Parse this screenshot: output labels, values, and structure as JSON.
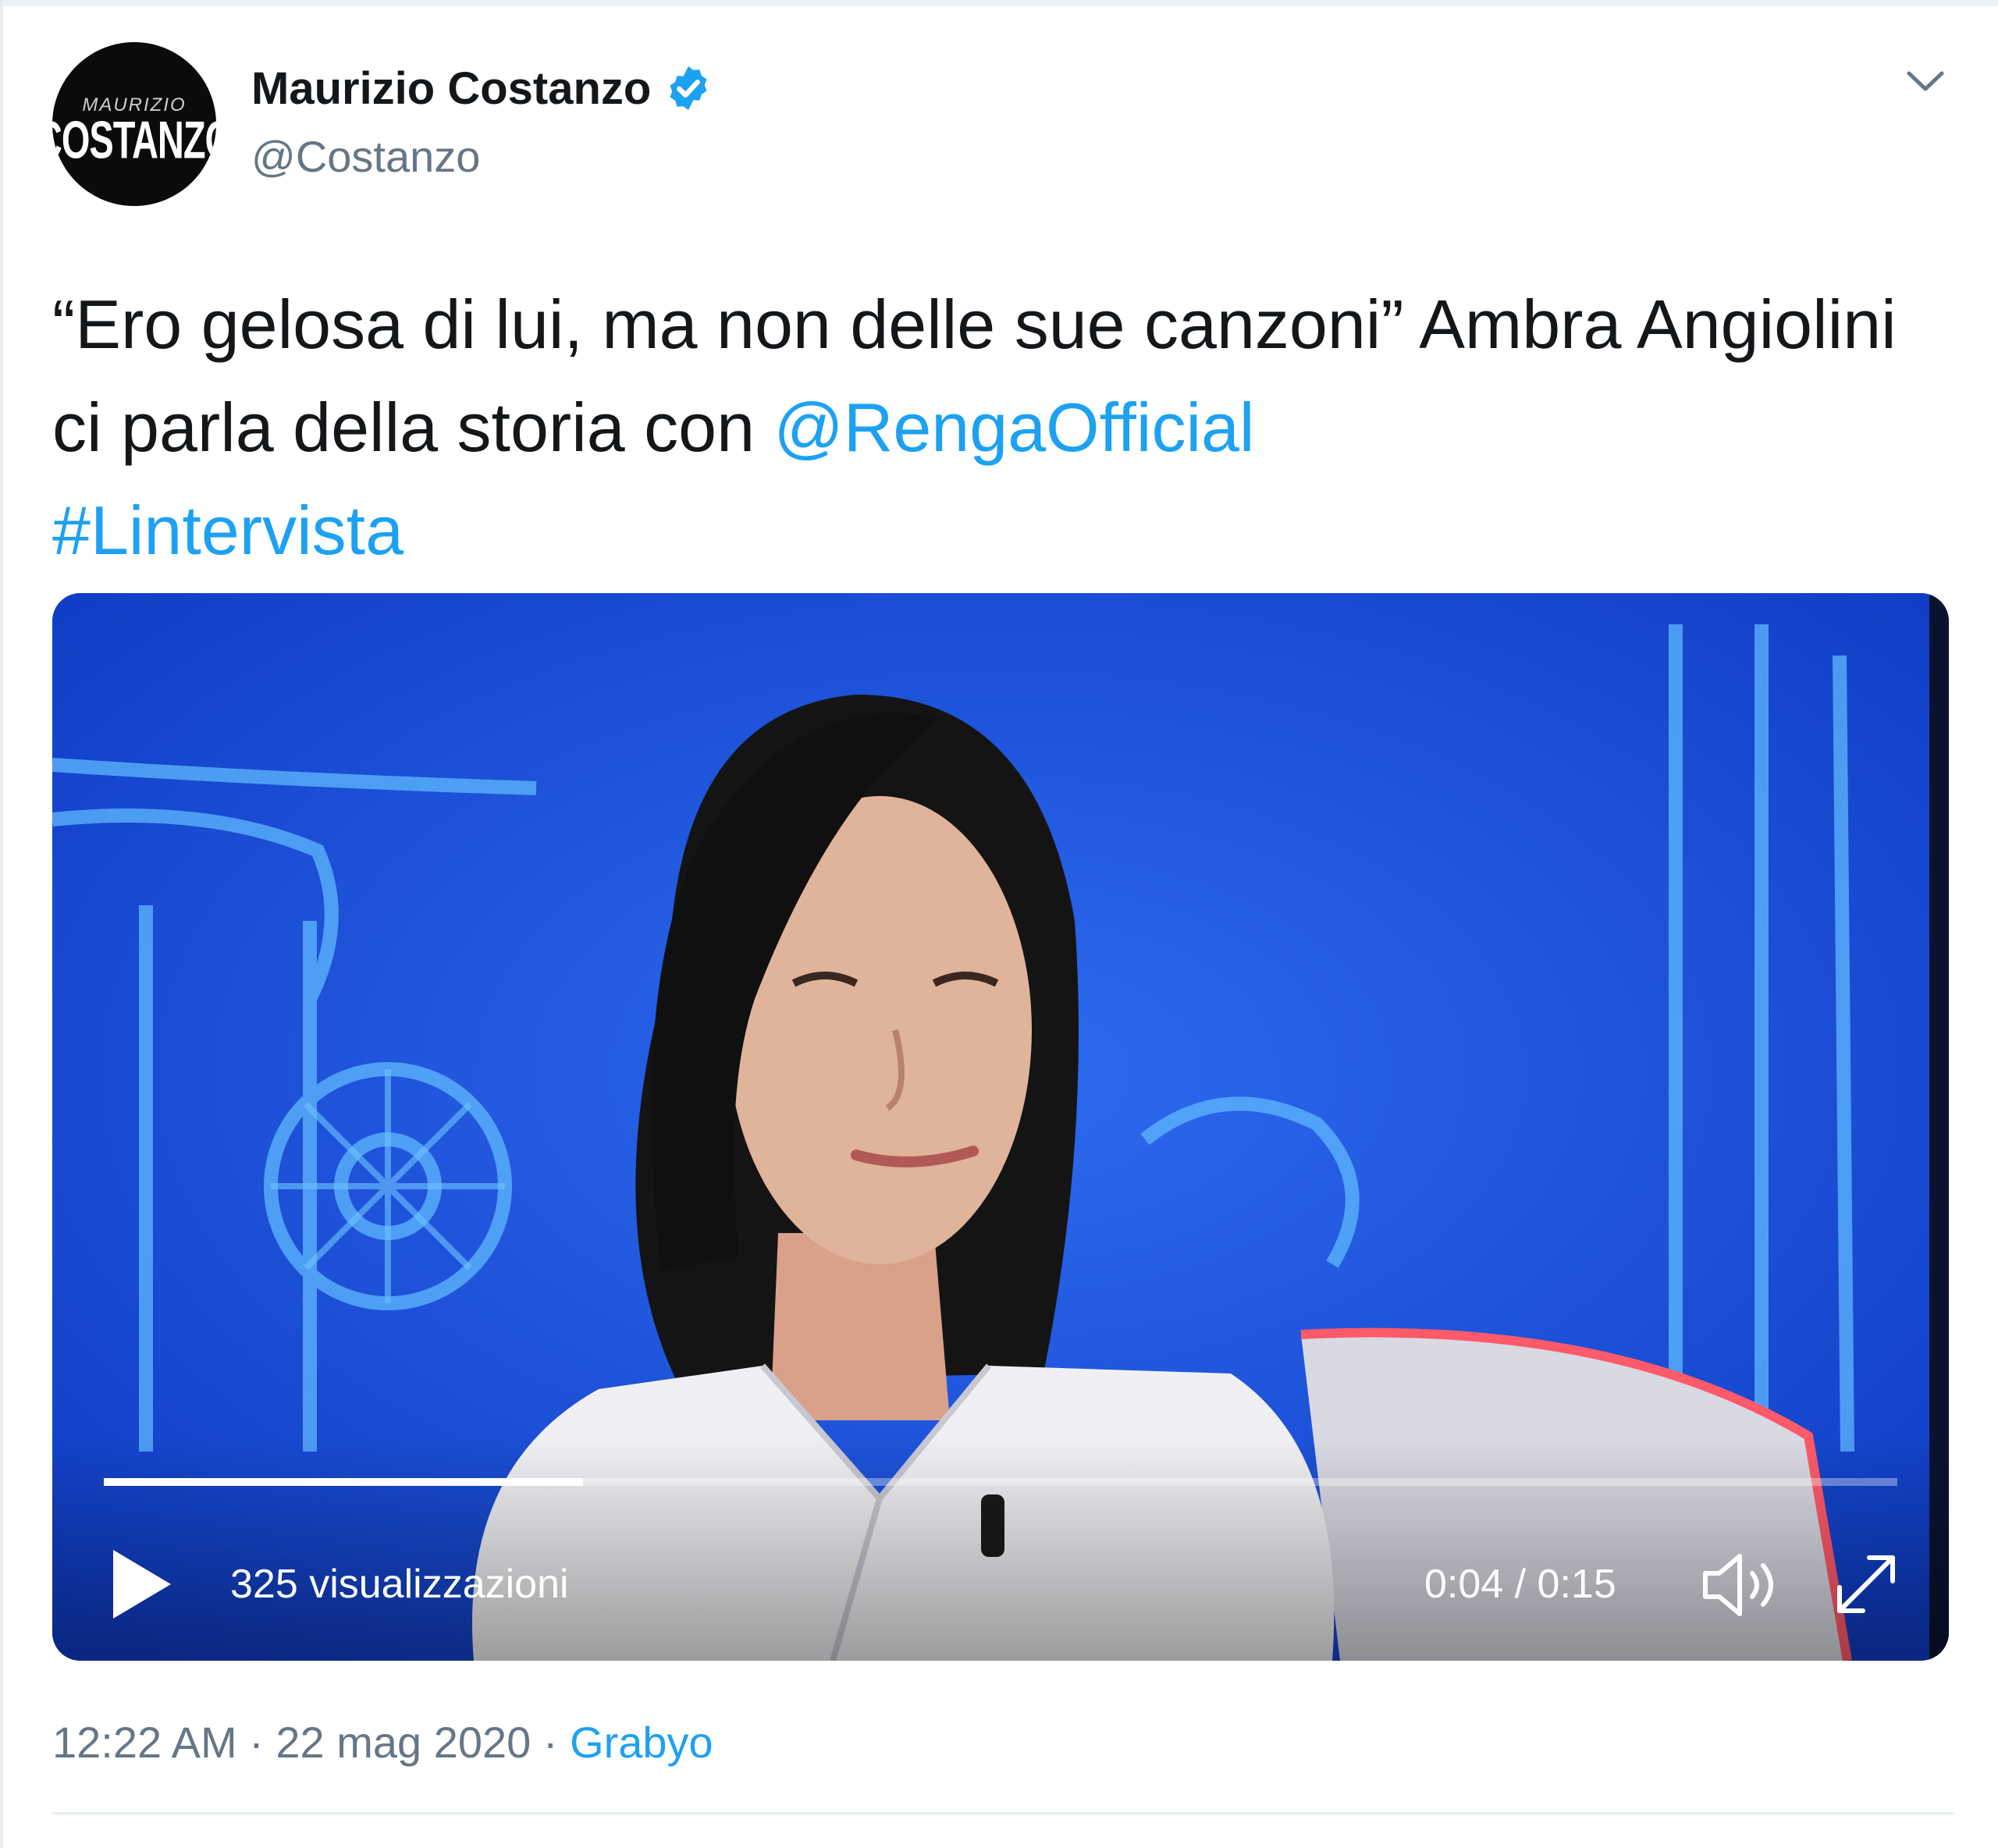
{
  "author": {
    "display_name": "Maurizio Costanzo",
    "handle": "@Costanzo",
    "verified": true,
    "avatar_text_small": "MAURIZIO",
    "avatar_text_big": "COSTANZO"
  },
  "tweet": {
    "text_plain": "“Ero gelosa di lui, ma non delle sue canzoni” Ambra Angiolini ci parla della storia con ",
    "mention": "@RengaOfficial",
    "hashtag": "#Lintervista"
  },
  "video": {
    "views": "325 visualizzazioni",
    "time": "0:04 / 0:15",
    "progress": 0.267
  },
  "footer": {
    "time": "12:22 AM",
    "separator": " · ",
    "date": "22 mag 2020",
    "source": "Grabyo"
  },
  "colors": {
    "link": "#1da1f2",
    "secondary_text": "#657786",
    "video_bg": "#1548d8"
  },
  "icons": {
    "verified": "verified-badge-icon",
    "menu": "chevron-down-icon",
    "play": "play-icon",
    "volume": "volume-icon",
    "fullscreen": "fullscreen-icon"
  }
}
